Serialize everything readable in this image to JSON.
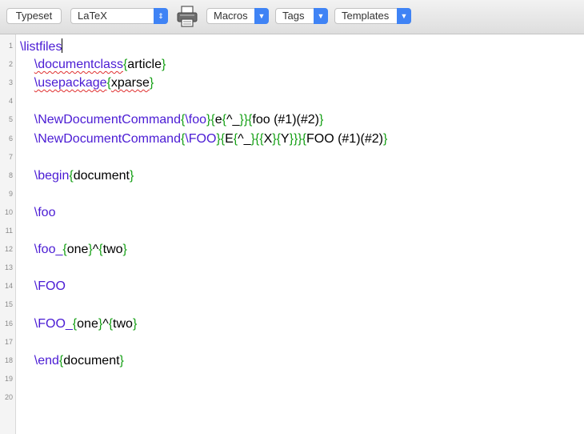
{
  "toolbar": {
    "typeset_label": "Typeset",
    "engine_value": "LaTeX",
    "macros_label": "Macros",
    "tags_label": "Tags",
    "templates_label": "Templates"
  },
  "editor": {
    "line_numbers": [
      "1",
      "2",
      "3",
      "4",
      "5",
      "6",
      "7",
      "8",
      "9",
      "10",
      "11",
      "12",
      "13",
      "14",
      "15",
      "16",
      "17",
      "18",
      "19",
      "20"
    ],
    "lines": [
      [
        {
          "t": "\\listfiles",
          "c": "cmd"
        }
      ],
      [
        {
          "t": "    "
        },
        {
          "t": "\\documentclass",
          "c": "cmd spell"
        },
        {
          "t": "{",
          "c": "br"
        },
        {
          "t": "article"
        },
        {
          "t": "}",
          "c": "br"
        }
      ],
      [
        {
          "t": "    "
        },
        {
          "t": "\\usepackage",
          "c": "cmd spell"
        },
        {
          "t": "{",
          "c": "br"
        },
        {
          "t": "xparse",
          "c": "spell"
        },
        {
          "t": "}",
          "c": "br"
        }
      ],
      [],
      [
        {
          "t": "    "
        },
        {
          "t": "\\NewDocumentCommand",
          "c": "cmd"
        },
        {
          "t": "{",
          "c": "br"
        },
        {
          "t": "\\foo",
          "c": "cmd"
        },
        {
          "t": "}{",
          "c": "br"
        },
        {
          "t": "e"
        },
        {
          "t": "{",
          "c": "br"
        },
        {
          "t": "^_"
        },
        {
          "t": "}}{",
          "c": "br"
        },
        {
          "t": "foo (#1)(#2)"
        },
        {
          "t": "}",
          "c": "br"
        }
      ],
      [
        {
          "t": "    "
        },
        {
          "t": "\\NewDocumentCommand",
          "c": "cmd"
        },
        {
          "t": "{",
          "c": "br"
        },
        {
          "t": "\\FOO",
          "c": "cmd"
        },
        {
          "t": "}{",
          "c": "br"
        },
        {
          "t": "E"
        },
        {
          "t": "{",
          "c": "br"
        },
        {
          "t": "^_"
        },
        {
          "t": "}{{",
          "c": "br"
        },
        {
          "t": "X"
        },
        {
          "t": "}{",
          "c": "br"
        },
        {
          "t": "Y"
        },
        {
          "t": "}}}{",
          "c": "br"
        },
        {
          "t": "FOO (#1)(#2)"
        },
        {
          "t": "}",
          "c": "br"
        }
      ],
      [],
      [
        {
          "t": "    "
        },
        {
          "t": "\\begin",
          "c": "cmd"
        },
        {
          "t": "{",
          "c": "br"
        },
        {
          "t": "document"
        },
        {
          "t": "}",
          "c": "br"
        }
      ],
      [],
      [
        {
          "t": "    "
        },
        {
          "t": "\\foo",
          "c": "cmd"
        }
      ],
      [],
      [
        {
          "t": "    "
        },
        {
          "t": "\\foo_",
          "c": "cmd"
        },
        {
          "t": "{",
          "c": "br"
        },
        {
          "t": "one"
        },
        {
          "t": "}",
          "c": "br"
        },
        {
          "t": "^"
        },
        {
          "t": "{",
          "c": "br"
        },
        {
          "t": "two"
        },
        {
          "t": "}",
          "c": "br"
        }
      ],
      [],
      [
        {
          "t": "    "
        },
        {
          "t": "\\FOO",
          "c": "cmd"
        }
      ],
      [],
      [
        {
          "t": "    "
        },
        {
          "t": "\\FOO_",
          "c": "cmd"
        },
        {
          "t": "{",
          "c": "br"
        },
        {
          "t": "one"
        },
        {
          "t": "}",
          "c": "br"
        },
        {
          "t": "^"
        },
        {
          "t": "{",
          "c": "br"
        },
        {
          "t": "two"
        },
        {
          "t": "}",
          "c": "br"
        }
      ],
      [],
      [
        {
          "t": "    "
        },
        {
          "t": "\\end",
          "c": "cmd"
        },
        {
          "t": "{",
          "c": "br"
        },
        {
          "t": "document"
        },
        {
          "t": "}",
          "c": "br"
        }
      ],
      [],
      []
    ]
  },
  "colors": {
    "command": "#4a1bd4",
    "brace": "#16a016",
    "accent": "#3f83f5"
  },
  "icons": {
    "printer": "printer-icon",
    "popup_arrow": "chevron-updown-icon"
  }
}
